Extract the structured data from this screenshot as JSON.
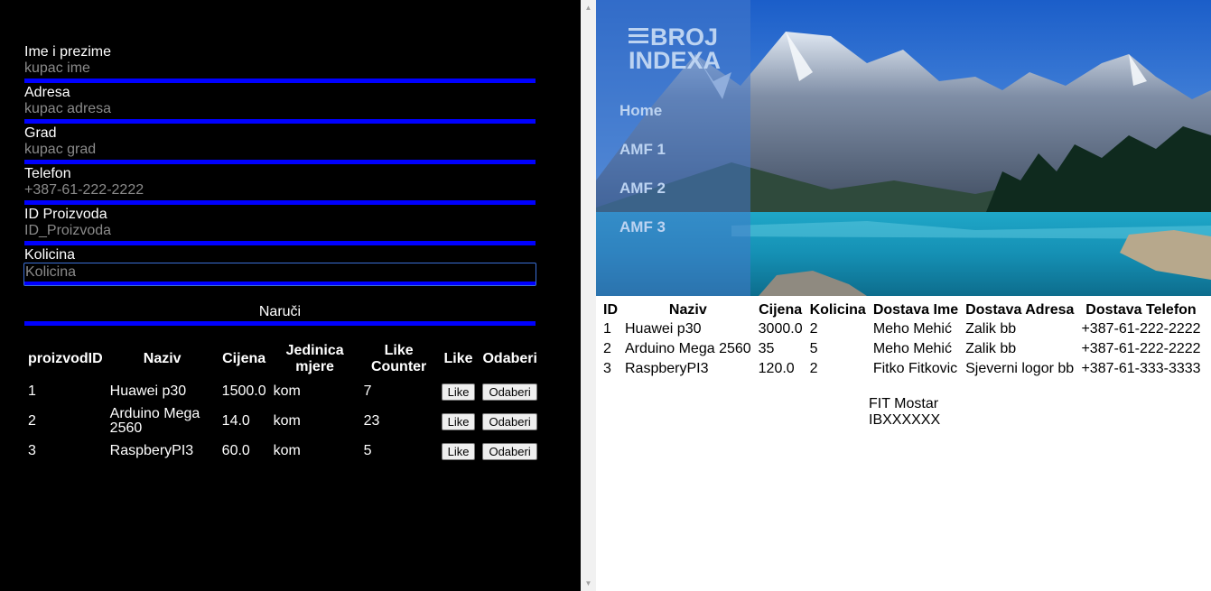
{
  "form": {
    "fields": [
      {
        "label": "Ime i prezime",
        "placeholder": "kupac ime"
      },
      {
        "label": "Adresa",
        "placeholder": "kupac adresa"
      },
      {
        "label": "Grad",
        "placeholder": "kupac grad"
      },
      {
        "label": "Telefon",
        "placeholder": "+387-61-222-2222"
      },
      {
        "label": "ID Proizvoda",
        "placeholder": "ID_Proizvoda"
      },
      {
        "label": "Kolicina",
        "placeholder": "Kolicina"
      }
    ],
    "submit_label": "Naruči"
  },
  "products": {
    "headers": [
      "proizvodID",
      "Naziv",
      "Cijena",
      "Jedinica mjere",
      "Like Counter",
      "Like",
      "Odaberi"
    ],
    "rows": [
      {
        "id": "1",
        "naziv": "Huawei p30",
        "cijena": "1500.0",
        "jedinica": "kom",
        "likes": "7",
        "like_btn": "Like",
        "odaberi_btn": "Odaberi"
      },
      {
        "id": "2",
        "naziv": "Arduino Mega 2560",
        "cijena": "14.0",
        "jedinica": "kom",
        "likes": "23",
        "like_btn": "Like",
        "odaberi_btn": "Odaberi"
      },
      {
        "id": "3",
        "naziv": "RaspberyPI3",
        "cijena": "60.0",
        "jedinica": "kom",
        "likes": "5",
        "like_btn": "Like",
        "odaberi_btn": "Odaberi"
      }
    ]
  },
  "sidebar": {
    "logo_line1": "BROJ",
    "logo_line2": "INDEXA",
    "nav": [
      "Home",
      "AMF 1",
      "AMF 2",
      "AMF 3"
    ]
  },
  "orders": {
    "headers": [
      "ID",
      "Naziv",
      "Cijena",
      "Kolicina",
      "Dostava Ime",
      "Dostava Adresa",
      "Dostava Telefon"
    ],
    "rows": [
      {
        "id": "1",
        "naziv": "Huawei p30",
        "cijena": "3000.0",
        "kolicina": "2",
        "ime": "Meho Mehić",
        "adresa": "Zalik bb",
        "telefon": "+387-61-222-2222"
      },
      {
        "id": "2",
        "naziv": "Arduino Mega 2560",
        "cijena": "35",
        "kolicina": "5",
        "ime": "Meho Mehić",
        "adresa": "Zalik bb",
        "telefon": "+387-61-222-2222"
      },
      {
        "id": "3",
        "naziv": "RaspberyPI3",
        "cijena": "120.0",
        "kolicina": "2",
        "ime": "Fitko Fitkovic",
        "adresa": "Sjeverni logor bb",
        "telefon": "+387-61-333-3333"
      }
    ]
  },
  "footer": {
    "line1": "FIT Mostar",
    "line2": "IBXXXXXX"
  },
  "colors": {
    "accent_bar": "#0000ff",
    "sidebar_overlay": "#4678c8"
  }
}
